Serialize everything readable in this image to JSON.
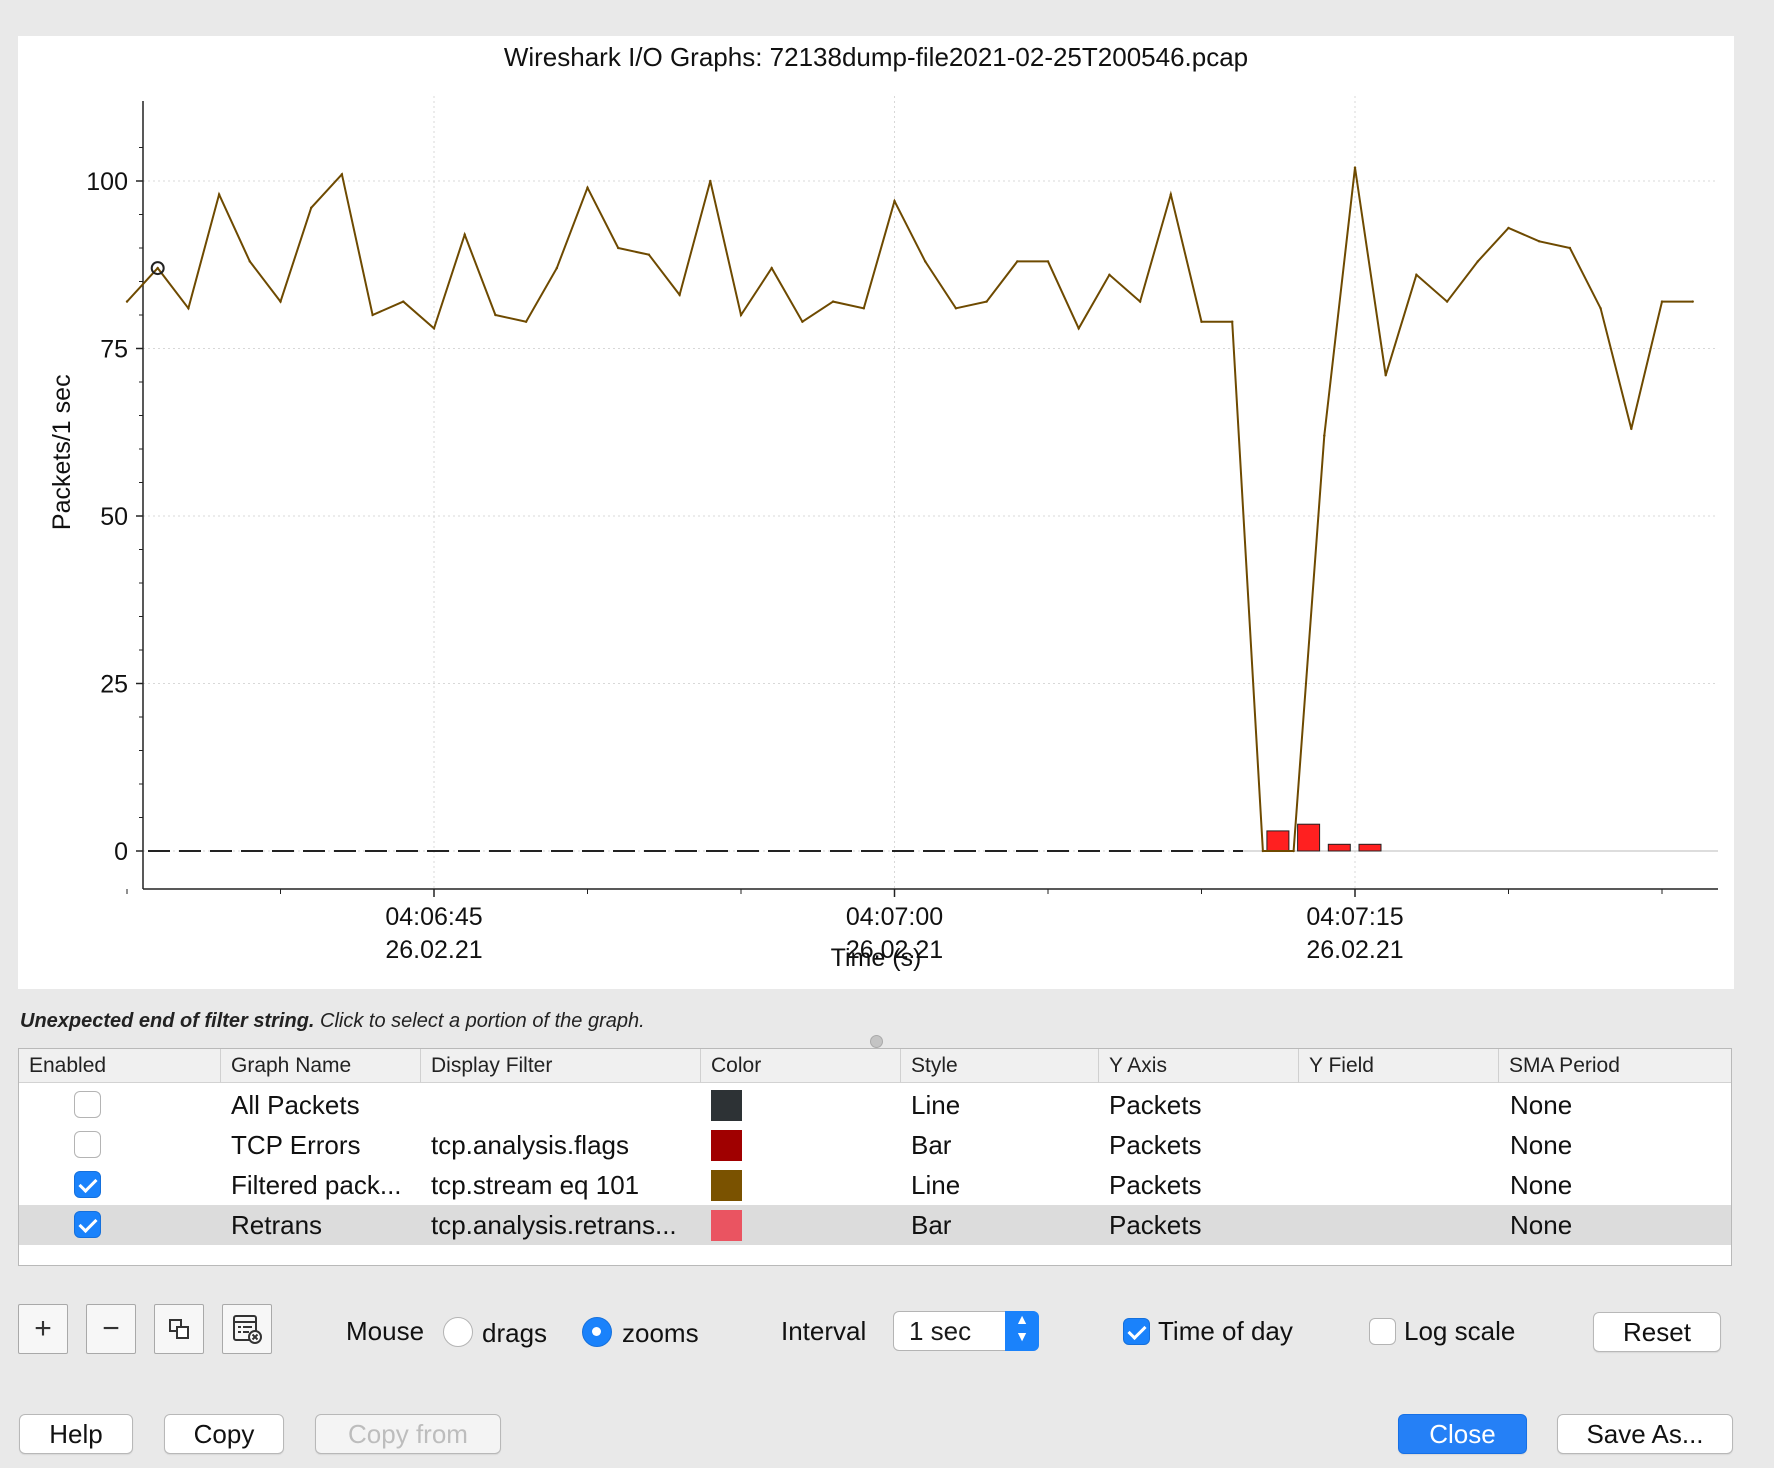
{
  "window": {
    "title": "Wireshark I/O Graphs: 72138dump-file2021-02-25T200546.pcap"
  },
  "chart_data": {
    "type": "line",
    "title": "Wireshark I/O Graphs: 72138dump-file2021-02-25T200546.pcap",
    "xlabel": "Time (s)",
    "ylabel": "Packets/1 sec",
    "ylim": [
      0,
      100
    ],
    "y_ticks": [
      "0",
      "25",
      "50",
      "75",
      "100"
    ],
    "x_ticks": [
      {
        "time": "04:06:45",
        "date": "26.02.21"
      },
      {
        "time": "04:07:00",
        "date": "26.02.21"
      },
      {
        "time": "04:07:15",
        "date": "26.02.21"
      }
    ],
    "series": [
      {
        "name": "Filtered pack...",
        "type": "line",
        "color": "#6e4a00",
        "x": [
          "04:06:35",
          "04:06:36",
          "04:06:37",
          "04:06:38",
          "04:06:39",
          "04:06:40",
          "04:06:41",
          "04:06:42",
          "04:06:43",
          "04:06:44",
          "04:06:45",
          "04:06:46",
          "04:06:47",
          "04:06:48",
          "04:06:49",
          "04:06:50",
          "04:06:51",
          "04:06:52",
          "04:06:53",
          "04:06:54",
          "04:06:55",
          "04:06:56",
          "04:06:57",
          "04:06:58",
          "04:06:59",
          "04:07:00",
          "04:07:01",
          "04:07:02",
          "04:07:03",
          "04:07:04",
          "04:07:05",
          "04:07:06",
          "04:07:07",
          "04:07:08",
          "04:07:09",
          "04:07:10",
          "04:07:11",
          "04:07:12",
          "04:07:13",
          "04:07:14",
          "04:07:15",
          "04:07:16",
          "04:07:17",
          "04:07:18",
          "04:07:19",
          "04:07:20",
          "04:07:21",
          "04:07:22",
          "04:07:23",
          "04:07:24",
          "04:07:25",
          "04:07:26"
        ],
        "values": [
          82,
          87,
          81,
          98,
          88,
          82,
          96,
          101,
          80,
          82,
          78,
          92,
          80,
          79,
          87,
          99,
          90,
          89,
          83,
          100,
          80,
          87,
          79,
          82,
          81,
          97,
          88,
          81,
          82,
          88,
          88,
          78,
          86,
          82,
          98,
          79,
          79,
          0,
          0,
          62,
          102,
          71,
          86,
          82,
          88,
          93,
          91,
          90,
          81,
          63,
          82,
          82
        ]
      },
      {
        "name": "Retrans",
        "type": "bar",
        "color": "#ff2020",
        "x": [
          "04:07:12",
          "04:07:13",
          "04:07:14",
          "04:07:15"
        ],
        "values": [
          3,
          4,
          1,
          1
        ]
      }
    ],
    "grid": true,
    "legend": "none"
  },
  "status": {
    "bold": "Unexpected end of filter string.",
    "text": " Click to select a portion of the graph."
  },
  "table": {
    "columns": [
      "Enabled",
      "Graph Name",
      "Display Filter",
      "Color",
      "Style",
      "Y Axis",
      "Y Field",
      "SMA Period"
    ],
    "rows": [
      {
        "enabled": false,
        "name": "All Packets",
        "filter": "",
        "color": "#2d3235",
        "style": "Line",
        "y_axis": "Packets",
        "y_field": "",
        "sma": "None"
      },
      {
        "enabled": false,
        "name": "TCP Errors",
        "filter": "tcp.analysis.flags",
        "color": "#a00000",
        "style": "Bar",
        "y_axis": "Packets",
        "y_field": "",
        "sma": "None"
      },
      {
        "enabled": true,
        "name": "Filtered pack...",
        "filter": "tcp.stream eq 101",
        "color": "#7a5200",
        "style": "Line",
        "y_axis": "Packets",
        "y_field": "",
        "sma": "None"
      },
      {
        "enabled": true,
        "name": "Retrans",
        "filter": "tcp.analysis.retrans...",
        "color": "#ea5461",
        "style": "Bar",
        "y_axis": "Packets",
        "y_field": "",
        "sma": "None"
      }
    ]
  },
  "toolbar": {
    "add_glyph": "+",
    "remove_glyph": "−",
    "add_icon": "plus-icon",
    "remove_icon": "minus-icon",
    "copy_icon": "copy-graph-icon",
    "clear_icon": "clear-graphs-icon"
  },
  "controls": {
    "mouse_label": "Mouse",
    "drags_label": "drags",
    "zooms_label": "zooms",
    "mouse_mode": "zooms",
    "interval_label": "Interval",
    "interval_value": "1 sec",
    "time_of_day_label": "Time of day",
    "time_of_day": true,
    "log_scale_label": "Log scale",
    "log_scale": false,
    "reset_label": "Reset"
  },
  "buttons": {
    "help": "Help",
    "copy": "Copy",
    "copy_from": "Copy from",
    "close": "Close",
    "save_as": "Save As..."
  }
}
